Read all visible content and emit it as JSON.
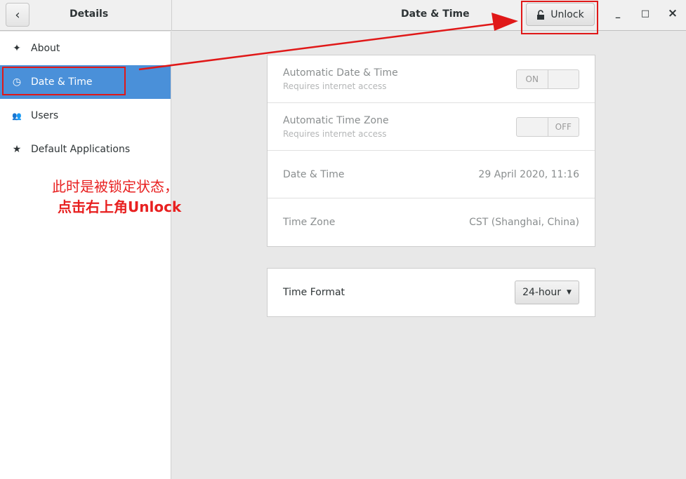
{
  "header": {
    "back_icon": "chevron-left-icon",
    "sidebar_title": "Details",
    "main_title": "Date & Time",
    "unlock_label": "Unlock",
    "lock_icon": "lock-icon",
    "minimize": "_",
    "maximize": "□",
    "close": "×"
  },
  "sidebar": {
    "items": [
      {
        "label": "About",
        "icon": "sparkle-icon",
        "glyph": "✦"
      },
      {
        "label": "Date & Time",
        "icon": "clock-icon",
        "glyph": "◷",
        "selected": true
      },
      {
        "label": "Users",
        "icon": "users-icon",
        "glyph": "👥"
      },
      {
        "label": "Default Applications",
        "icon": "star-icon",
        "glyph": "★"
      }
    ]
  },
  "settings": {
    "auto_dt": {
      "label": "Automatic Date & Time",
      "sub": "Requires internet access",
      "state": "ON"
    },
    "auto_tz": {
      "label": "Automatic Time Zone",
      "sub": "Requires internet access",
      "state": "OFF"
    },
    "date_time": {
      "label": "Date & Time",
      "value": "29 April 2020, 11:16"
    },
    "time_zone": {
      "label": "Time Zone",
      "value": "CST (Shanghai, China)"
    },
    "time_format": {
      "label": "Time Format",
      "value": "24-hour"
    }
  },
  "annotation": {
    "line1": "此时是被锁定状态，",
    "line2": "点击右上角Unlock",
    "color": "#e01818"
  },
  "colors": {
    "accent": "#4a90d9"
  }
}
